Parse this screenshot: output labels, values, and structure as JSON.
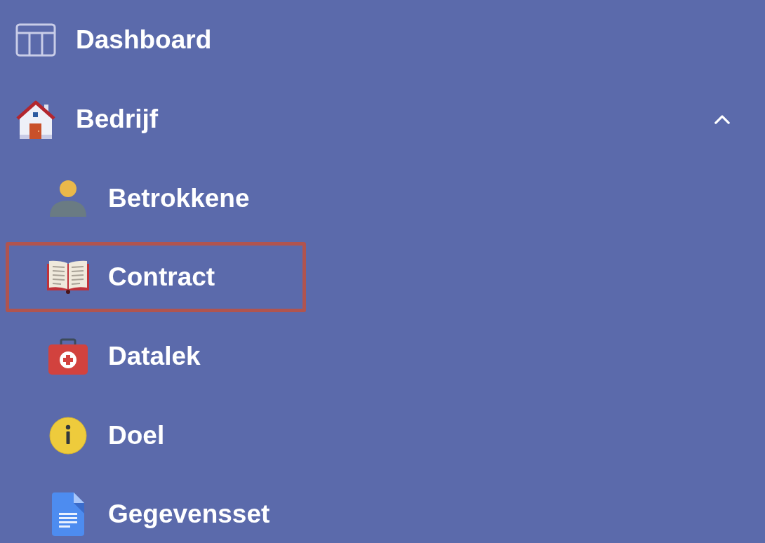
{
  "sidebar": {
    "items": [
      {
        "label": "Dashboard",
        "highlighted": false
      },
      {
        "label": "Bedrijf",
        "highlighted": false,
        "expanded": true,
        "children": [
          {
            "label": "Betrokkene",
            "highlighted": false
          },
          {
            "label": "Contract",
            "highlighted": true
          },
          {
            "label": "Datalek",
            "highlighted": false
          },
          {
            "label": "Doel",
            "highlighted": false
          },
          {
            "label": "Gegevensset",
            "highlighted": false
          }
        ]
      }
    ]
  }
}
